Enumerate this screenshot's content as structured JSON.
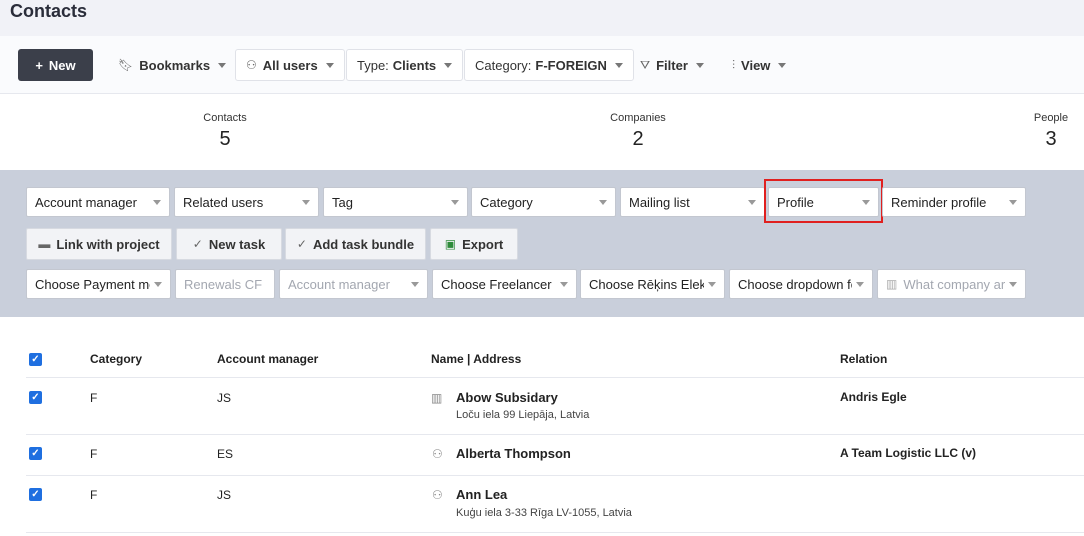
{
  "page": {
    "title": "Contacts"
  },
  "toolbar": {
    "new_label": "New",
    "bookmarks_label": "Bookmarks",
    "users_label": "All users",
    "type_prefix": "Type:",
    "type_value": "Clients",
    "category_prefix": "Category:",
    "category_value": "F-FOREIGN",
    "filter_label": "Filter",
    "view_label": "View"
  },
  "stats": [
    {
      "label": "Contacts",
      "value": "5"
    },
    {
      "label": "Companies",
      "value": "2"
    },
    {
      "label": "People",
      "value": "3"
    }
  ],
  "filters": {
    "row1": [
      "Account manager",
      "Related users",
      "Tag",
      "Category",
      "Mailing list",
      "Profile",
      "Reminder profile"
    ],
    "actions": [
      "Link with project",
      "New task",
      "Add task bundle",
      "Export"
    ],
    "row3": [
      "Choose Payment me",
      "Renewals CF",
      "Account manager",
      "Choose Freelancer li",
      "Choose Rēķins Elekt",
      "Choose dropdown fo",
      "What company are"
    ]
  },
  "table": {
    "headers": [
      "Category",
      "Account manager",
      "Name | Address",
      "Relation"
    ],
    "rows": [
      {
        "category": "F",
        "manager": "JS",
        "name": "Abow Subsidary",
        "address": "Loču iela 99 Liepāja, Latvia",
        "relation": "Andris Egle",
        "icon": "building-icon"
      },
      {
        "category": "F",
        "manager": "ES",
        "name": "Alberta Thompson",
        "address": "",
        "relation": "A Team Logistic LLC (v)",
        "icon": "person-icon"
      },
      {
        "category": "F",
        "manager": "JS",
        "name": "Ann Lea",
        "address": "Kuģu iela 3-33 Rīga LV-1055, Latvia",
        "relation": "",
        "icon": "person-icon"
      }
    ]
  },
  "colors": {
    "accent": "#1f6fe0",
    "highlight": "#e0201f",
    "filter_bg": "#c9cfdb",
    "dark_button": "#3b3f4a"
  }
}
